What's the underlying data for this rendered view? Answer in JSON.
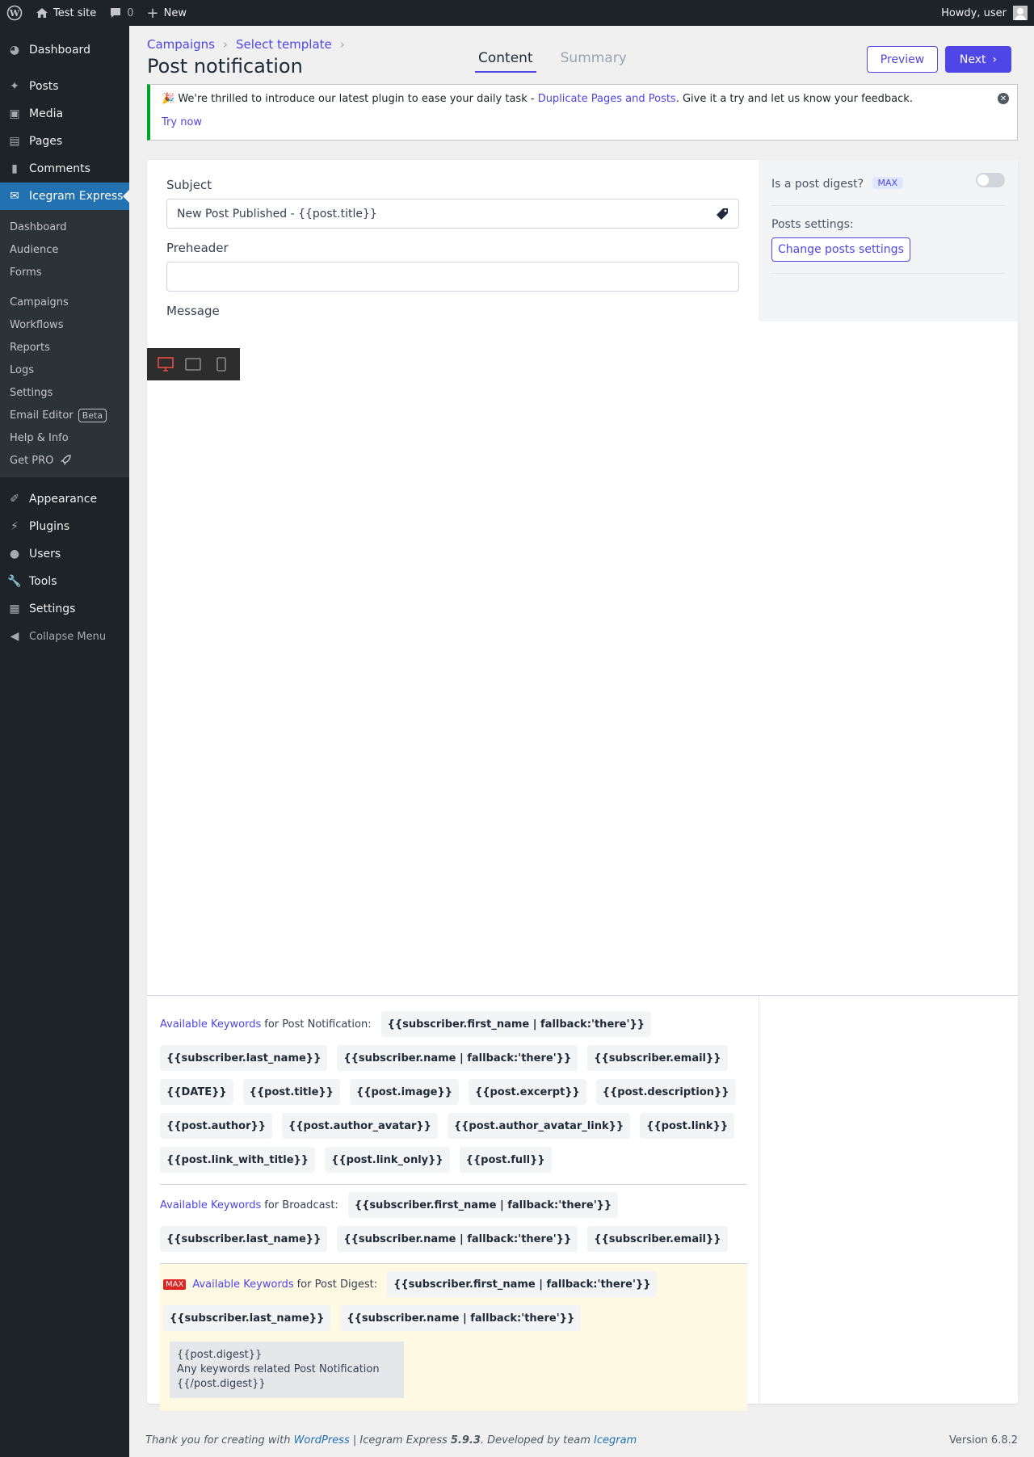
{
  "adminbar": {
    "site_name": "Test site",
    "comments_count": "0",
    "new_label": "New",
    "howdy": "Howdy, user"
  },
  "sidebar": {
    "items_top": [
      {
        "label": "Dashboard",
        "icon": "dashboard-icon"
      },
      {
        "label": "Posts",
        "icon": "pin-icon"
      },
      {
        "label": "Media",
        "icon": "media-icon"
      },
      {
        "label": "Pages",
        "icon": "pages-icon"
      },
      {
        "label": "Comments",
        "icon": "comment-icon"
      },
      {
        "label": "Icegram Express",
        "icon": "mail-icon"
      }
    ],
    "submenu": [
      "Dashboard",
      "Audience",
      "Forms",
      "Campaigns",
      "Workflows",
      "Reports",
      "Logs",
      "Settings",
      "Email Editor",
      "Help & Info",
      "Get PRO"
    ],
    "beta_badge": "Beta",
    "items_bottom": [
      {
        "label": "Appearance",
        "icon": "brush-icon"
      },
      {
        "label": "Plugins",
        "icon": "plugin-icon"
      },
      {
        "label": "Users",
        "icon": "user-icon"
      },
      {
        "label": "Tools",
        "icon": "wrench-icon"
      },
      {
        "label": "Settings",
        "icon": "settings-icon"
      },
      {
        "label": "Collapse Menu",
        "icon": "collapse-icon"
      }
    ]
  },
  "header": {
    "breadcrumbs": [
      "Campaigns",
      "Select template"
    ],
    "title": "Post notification",
    "tabs": [
      "Content",
      "Summary"
    ],
    "preview_label": "Preview",
    "next_label": "Next"
  },
  "notice": {
    "text_before": "We're thrilled to introduce our latest plugin to ease your daily task - ",
    "link_text": "Duplicate Pages and Posts",
    "text_after": ". Give it a try and let us know your feedback.",
    "try_now": "Try now"
  },
  "form": {
    "subject_label": "Subject",
    "subject_value": "New Post Published - {{post.title}}",
    "preheader_label": "Preheader",
    "preheader_value": "",
    "message_label": "Message"
  },
  "settings_panel": {
    "digest_label": "Is a post digest?",
    "digest_badge": "MAX",
    "posts_settings_label": "Posts settings:",
    "change_button": "Change posts settings"
  },
  "keywords": {
    "available_link": "Available Keywords",
    "post_notification": {
      "label": "for Post Notification:",
      "chips": [
        "{{subscriber.first_name | fallback:'there'}}",
        "{{subscriber.last_name}}",
        "{{subscriber.name | fallback:'there'}}",
        "{{subscriber.email}}",
        "{{DATE}}",
        "{{post.title}}",
        "{{post.image}}",
        "{{post.excerpt}}",
        "{{post.description}}",
        "{{post.author}}",
        "{{post.author_avatar}}",
        "{{post.author_avatar_link}}",
        "{{post.link}}",
        "{{post.link_with_title}}",
        "{{post.link_only}}",
        "{{post.full}}"
      ]
    },
    "broadcast": {
      "label": "for Broadcast:",
      "chips": [
        "{{subscriber.first_name | fallback:'there'}}",
        "{{subscriber.last_name}}",
        "{{subscriber.name | fallback:'there'}}",
        "{{subscriber.email}}"
      ]
    },
    "digest": {
      "badge": "MAX",
      "label": "for Post Digest:",
      "chips": [
        "{{subscriber.first_name | fallback:'there'}}",
        "{{subscriber.last_name}}",
        "{{subscriber.name | fallback:'there'}}"
      ],
      "code_lines": [
        "{{post.digest}}",
        "Any keywords related Post Notification",
        "{{/post.digest}}"
      ]
    }
  },
  "footer": {
    "text_1": "Thank you for creating with ",
    "wp_link": "WordPress",
    "text_2": " | Icegram Express ",
    "plugin_version": "5.9.3",
    "text_3": ". Developed by team ",
    "team_link": "Icegram",
    "version": "Version 6.8.2"
  },
  "colors": {
    "accent": "#4f46e5",
    "wp_blue": "#2271b1",
    "notice_green": "#00a32a",
    "max_red": "#dc2626"
  }
}
